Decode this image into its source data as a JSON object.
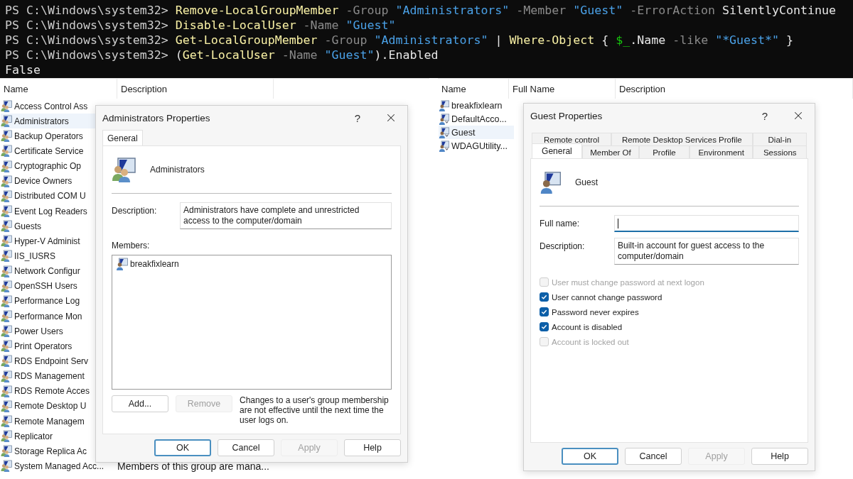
{
  "terminal": {
    "lines": [
      {
        "tokens": [
          {
            "kind": "prompt",
            "text": "PS C:\\Windows\\system32> "
          },
          {
            "kind": "command",
            "text": "Remove-LocalGroupMember"
          },
          {
            "kind": "parameter",
            "text": " -Group "
          },
          {
            "kind": "string",
            "text": "\"Administrators\""
          },
          {
            "kind": "parameter",
            "text": " -Member "
          },
          {
            "kind": "string",
            "text": "\"Guest\""
          },
          {
            "kind": "parameter",
            "text": " -ErrorAction "
          },
          {
            "kind": "plain",
            "text": "SilentlyContinue"
          }
        ]
      },
      {
        "tokens": [
          {
            "kind": "prompt",
            "text": "PS C:\\Windows\\system32> "
          },
          {
            "kind": "command",
            "text": "Disable-LocalUser"
          },
          {
            "kind": "parameter",
            "text": " -Name "
          },
          {
            "kind": "string",
            "text": "\"Guest\""
          }
        ]
      },
      {
        "tokens": [
          {
            "kind": "prompt",
            "text": "PS C:\\Windows\\system32> "
          },
          {
            "kind": "command",
            "text": "Get-LocalGroupMember"
          },
          {
            "kind": "parameter",
            "text": " -Group "
          },
          {
            "kind": "string",
            "text": "\"Administrators\""
          },
          {
            "kind": "plain",
            "text": " | "
          },
          {
            "kind": "command",
            "text": "Where-Object"
          },
          {
            "kind": "plain",
            "text": " { "
          },
          {
            "kind": "variable",
            "text": "$_"
          },
          {
            "kind": "plain",
            "text": ".Name "
          },
          {
            "kind": "parameter",
            "text": "-like "
          },
          {
            "kind": "string",
            "text": "\"*Guest*\""
          },
          {
            "kind": "plain",
            "text": " }"
          }
        ]
      },
      {
        "tokens": [
          {
            "kind": "prompt",
            "text": "PS C:\\Windows\\system32> "
          },
          {
            "kind": "plain",
            "text": "("
          },
          {
            "kind": "command",
            "text": "Get-LocalUser"
          },
          {
            "kind": "parameter",
            "text": " -Name "
          },
          {
            "kind": "string",
            "text": "\"Guest\""
          },
          {
            "kind": "plain",
            "text": ").Enabled"
          }
        ]
      },
      {
        "tokens": [
          {
            "kind": "plain",
            "text": "False"
          }
        ]
      }
    ]
  },
  "groups_list": {
    "columns": [
      "Name",
      "Description"
    ],
    "rows": [
      {
        "name": "Access Control Ass",
        "selected": false
      },
      {
        "name": "Administrators",
        "selected": true
      },
      {
        "name": "Backup Operators",
        "selected": false
      },
      {
        "name": "Certificate Service",
        "selected": false
      },
      {
        "name": "Cryptographic Op",
        "selected": false
      },
      {
        "name": "Device Owners",
        "selected": false
      },
      {
        "name": "Distributed COM U",
        "selected": false
      },
      {
        "name": "Event Log Readers",
        "selected": false
      },
      {
        "name": "Guests",
        "selected": false
      },
      {
        "name": "Hyper-V Administ",
        "selected": false
      },
      {
        "name": "IIS_IUSRS",
        "selected": false
      },
      {
        "name": "Network Configur",
        "selected": false
      },
      {
        "name": "OpenSSH Users",
        "selected": false
      },
      {
        "name": "Performance Log",
        "selected": false
      },
      {
        "name": "Performance Mon",
        "selected": false
      },
      {
        "name": "Power Users",
        "selected": false
      },
      {
        "name": "Print Operators",
        "selected": false
      },
      {
        "name": "RDS Endpoint Serv",
        "selected": false
      },
      {
        "name": "RDS Management",
        "selected": false
      },
      {
        "name": "RDS Remote Acces",
        "selected": false
      },
      {
        "name": "Remote Desktop U",
        "selected": false
      },
      {
        "name": "Remote Managem",
        "selected": false
      },
      {
        "name": "Replicator",
        "selected": false
      },
      {
        "name": "Storage Replica Ac",
        "selected": false
      },
      {
        "name": "System Managed Acc...",
        "description": "Members of this group are mana...",
        "selected": false
      }
    ]
  },
  "admin_dialog": {
    "title": "Administrators Properties",
    "help": "?",
    "tabs": [
      {
        "label": "General",
        "selected": true
      }
    ],
    "name": "Administrators",
    "description_label": "Description:",
    "description": "Administrators have complete and unrestricted access to the computer/domain",
    "members_label": "Members:",
    "members": [
      {
        "name": "breakfixlearn"
      }
    ],
    "member_buttons": [
      {
        "label": "Add...",
        "disabled": false
      },
      {
        "label": "Remove",
        "disabled": true
      }
    ],
    "note": "Changes to a user's group membership are not effective until the next time the user logs on.",
    "buttons": [
      {
        "label": "OK",
        "default": true,
        "disabled": false
      },
      {
        "label": "Cancel",
        "default": false,
        "disabled": false
      },
      {
        "label": "Apply",
        "default": false,
        "disabled": true
      },
      {
        "label": "Help",
        "default": false,
        "disabled": false
      }
    ]
  },
  "users_list": {
    "columns": [
      "Name",
      "Full Name",
      "Description"
    ],
    "rows": [
      {
        "name": "breakfixlearn",
        "kind": "admin",
        "selected": false
      },
      {
        "name": "DefaultAcco...",
        "kind": "user",
        "selected": false
      },
      {
        "name": "Guest",
        "kind": "user",
        "selected": true
      },
      {
        "name": "WDAGUtility...",
        "kind": "user",
        "selected": false
      }
    ]
  },
  "guest_dialog": {
    "title": "Guest Properties",
    "help": "?",
    "tab_rows": [
      [
        {
          "label": "Remote control",
          "selected": false
        },
        {
          "label": "Remote Desktop Services Profile",
          "selected": false
        },
        {
          "label": "Dial-in",
          "selected": false
        }
      ],
      [
        {
          "label": "General",
          "selected": true
        },
        {
          "label": "Member Of",
          "selected": false
        },
        {
          "label": "Profile",
          "selected": false
        },
        {
          "label": "Environment",
          "selected": false
        },
        {
          "label": "Sessions",
          "selected": false
        }
      ]
    ],
    "name": "Guest",
    "fields": [
      {
        "label": "Full name:",
        "focused": true
      },
      {
        "label": "Description:",
        "value": "Built-in account for guest access to the computer/domain",
        "focused": false
      }
    ],
    "checkboxes": [
      {
        "label": "User must change password at next logon",
        "checked": false,
        "disabled": true
      },
      {
        "label": "User cannot change password",
        "checked": true,
        "disabled": false
      },
      {
        "label": "Password never expires",
        "checked": true,
        "disabled": false
      },
      {
        "label": "Account is disabled",
        "checked": true,
        "disabled": false
      },
      {
        "label": "Account is locked out",
        "checked": false,
        "disabled": true
      }
    ],
    "buttons": [
      {
        "label": "OK",
        "default": true,
        "disabled": false
      },
      {
        "label": "Cancel",
        "default": false,
        "disabled": false
      },
      {
        "label": "Apply",
        "default": false,
        "disabled": true
      },
      {
        "label": "Help",
        "default": false,
        "disabled": false
      }
    ]
  }
}
